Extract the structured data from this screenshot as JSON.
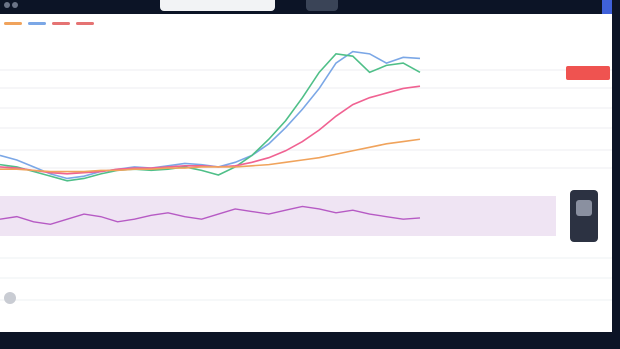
{
  "app": {
    "accent": "#3f61d9",
    "background": "#ffffff",
    "frame_dark": "#0c1426"
  },
  "legend": {
    "items": [
      {
        "color": "#f0a35c"
      },
      {
        "color": "#7ba7e6"
      },
      {
        "color": "#e57373"
      },
      {
        "color": "#e57373"
      }
    ]
  },
  "price_tag": {
    "text": "",
    "color": "#ef5350"
  },
  "chart_data": {
    "type": "line",
    "series": [
      {
        "color": "#7ba7e6",
        "values": [
          60,
          56,
          50,
          44,
          40,
          42,
          46,
          48,
          50,
          49,
          51,
          53,
          52,
          50,
          54,
          60,
          70,
          84,
          100,
          118,
          140,
          150,
          148,
          140,
          145,
          144
        ]
      },
      {
        "color": "#4fbf88",
        "values": [
          52,
          50,
          46,
          42,
          38,
          40,
          44,
          47,
          48,
          47,
          48,
          50,
          47,
          43,
          50,
          60,
          74,
          90,
          110,
          132,
          148,
          146,
          132,
          138,
          140,
          132
        ]
      },
      {
        "color": "#f06292",
        "values": [
          50,
          49,
          47,
          45,
          44,
          45,
          46,
          48,
          49,
          49,
          50,
          51,
          51,
          50,
          51,
          54,
          58,
          64,
          72,
          82,
          94,
          104,
          110,
          114,
          118,
          120
        ]
      },
      {
        "color": "#f0a35c",
        "values": [
          48,
          48,
          47,
          46,
          46,
          46,
          47,
          47,
          48,
          48,
          49,
          49,
          50,
          50,
          50,
          51,
          52,
          54,
          56,
          58,
          61,
          64,
          67,
          70,
          72,
          74
        ]
      }
    ],
    "rsi": {
      "color": "#b65ac4",
      "values": [
        50,
        52,
        48,
        46,
        50,
        54,
        52,
        48,
        50,
        53,
        55,
        52,
        50,
        54,
        58,
        56,
        54,
        57,
        60,
        58,
        55,
        57,
        54,
        52,
        50,
        51
      ]
    },
    "grid": true
  }
}
